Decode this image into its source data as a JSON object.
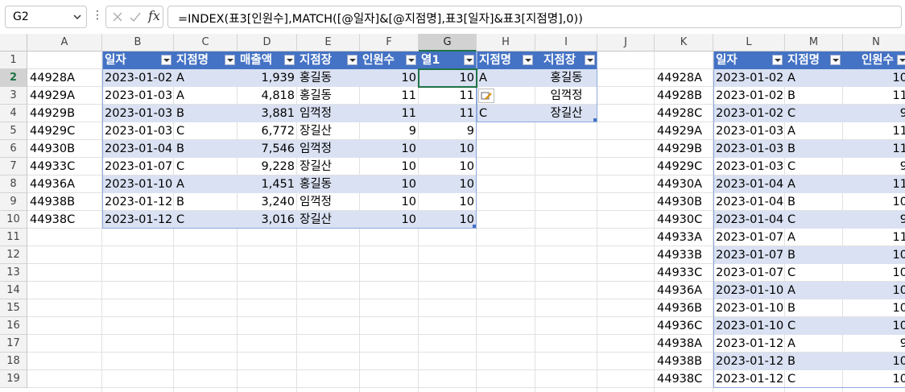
{
  "formula_bar": {
    "name_box": "G2",
    "formula": "=INDEX(표3[인원수],MATCH([@일자]&[@지점명],표3[일자]&표3[지점명],0))"
  },
  "columns": [
    "A",
    "B",
    "C",
    "D",
    "E",
    "F",
    "G",
    "H",
    "I",
    "J",
    "K",
    "L",
    "M",
    "N"
  ],
  "rows": [
    "1",
    "2",
    "3",
    "4",
    "5",
    "6",
    "7",
    "8",
    "9",
    "10",
    "11",
    "12",
    "13",
    "14",
    "15",
    "16",
    "17",
    "18",
    "19"
  ],
  "selected_column": "G",
  "selected_row": "2",
  "colA": [
    "44928A",
    "44929A",
    "44929B",
    "44929C",
    "44930B",
    "44933C",
    "44936A",
    "44938B",
    "44938C"
  ],
  "table1": {
    "headers": [
      "일자",
      "지점명",
      "매출액",
      "지점장",
      "인원수",
      "열1"
    ],
    "rows": [
      [
        "2023-01-02",
        "A",
        "1,939",
        "홍길동",
        "10",
        "10"
      ],
      [
        "2023-01-03",
        "A",
        "4,818",
        "홍길동",
        "11",
        "11"
      ],
      [
        "2023-01-03",
        "B",
        "3,881",
        "임꺽정",
        "11",
        "11"
      ],
      [
        "2023-01-03",
        "C",
        "6,772",
        "장길산",
        "9",
        "9"
      ],
      [
        "2023-01-04",
        "B",
        "7,546",
        "임꺽정",
        "10",
        "10"
      ],
      [
        "2023-01-07",
        "C",
        "9,228",
        "장길산",
        "10",
        "10"
      ],
      [
        "2023-01-10",
        "A",
        "1,451",
        "홍길동",
        "10",
        "10"
      ],
      [
        "2023-01-12",
        "B",
        "3,240",
        "임꺽정",
        "10",
        "10"
      ],
      [
        "2023-01-12",
        "C",
        "3,016",
        "장길산",
        "10",
        "10"
      ]
    ]
  },
  "table2": {
    "headers": [
      "지점명",
      "지점장"
    ],
    "rows": [
      [
        "A",
        "홍길동"
      ],
      [
        "",
        "임꺽정"
      ],
      [
        "C",
        "장길산"
      ]
    ]
  },
  "colK": [
    "44928A",
    "44928B",
    "44928C",
    "44929A",
    "44929B",
    "44929C",
    "44930A",
    "44930B",
    "44930C",
    "44933A",
    "44933B",
    "44933C",
    "44936A",
    "44936B",
    "44936C",
    "44938A",
    "44938B",
    "44938C"
  ],
  "table3": {
    "headers": [
      "일자",
      "지점명",
      "인원수"
    ],
    "rows": [
      [
        "2023-01-02",
        "A",
        "10"
      ],
      [
        "2023-01-02",
        "B",
        "11"
      ],
      [
        "2023-01-02",
        "C",
        "9"
      ],
      [
        "2023-01-03",
        "A",
        "11"
      ],
      [
        "2023-01-03",
        "B",
        "11"
      ],
      [
        "2023-01-03",
        "C",
        "9"
      ],
      [
        "2023-01-04",
        "A",
        "11"
      ],
      [
        "2023-01-04",
        "B",
        "10"
      ],
      [
        "2023-01-04",
        "C",
        "9"
      ],
      [
        "2023-01-07",
        "A",
        "11"
      ],
      [
        "2023-01-07",
        "B",
        "10"
      ],
      [
        "2023-01-07",
        "C",
        "10"
      ],
      [
        "2023-01-10",
        "A",
        "10"
      ],
      [
        "2023-01-10",
        "B",
        "10"
      ],
      [
        "2023-01-10",
        "C",
        "10"
      ],
      [
        "2023-01-12",
        "A",
        "9"
      ],
      [
        "2023-01-12",
        "B",
        "10"
      ],
      [
        "2023-01-12",
        "C",
        "10"
      ]
    ]
  },
  "icons": {
    "cancel": "x-icon",
    "enter": "check-icon",
    "function": "fx-icon",
    "paste_options": "paste-options-icon"
  },
  "colors": {
    "table_header": "#4472c4",
    "band": "#d9e1f2",
    "selection": "#217346"
  }
}
